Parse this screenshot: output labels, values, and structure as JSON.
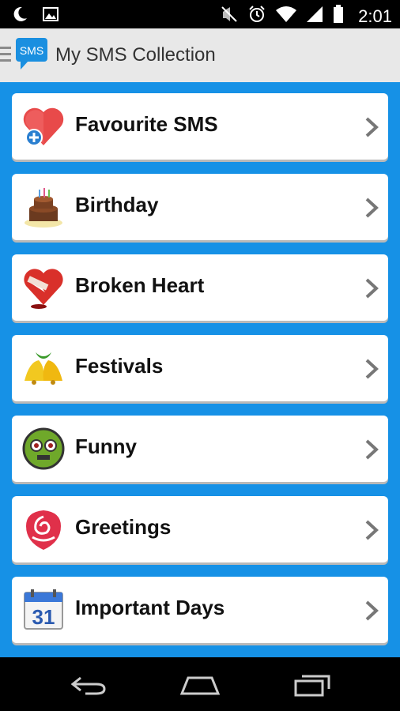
{
  "status_bar": {
    "time": "2:01",
    "icons": [
      "moon-icon",
      "image-icon",
      "mute-icon",
      "alarm-icon",
      "wifi-icon",
      "signal-icon",
      "battery-icon"
    ]
  },
  "action_bar": {
    "logo_text": "SMS",
    "title": "My SMS Collection"
  },
  "categories": [
    {
      "label": "Favourite SMS",
      "icon": "heart-plus-icon"
    },
    {
      "label": "Birthday",
      "icon": "cake-icon"
    },
    {
      "label": "Broken Heart",
      "icon": "broken-heart-icon"
    },
    {
      "label": "Festivals",
      "icon": "bells-icon"
    },
    {
      "label": "Funny",
      "icon": "funny-face-icon"
    },
    {
      "label": "Greetings",
      "icon": "rose-icon"
    },
    {
      "label": "Important Days",
      "icon": "calendar-icon",
      "calendar_day": "31"
    }
  ],
  "colors": {
    "background": "#1691e6",
    "action_bar": "#e8e8e8",
    "card": "#ffffff"
  }
}
